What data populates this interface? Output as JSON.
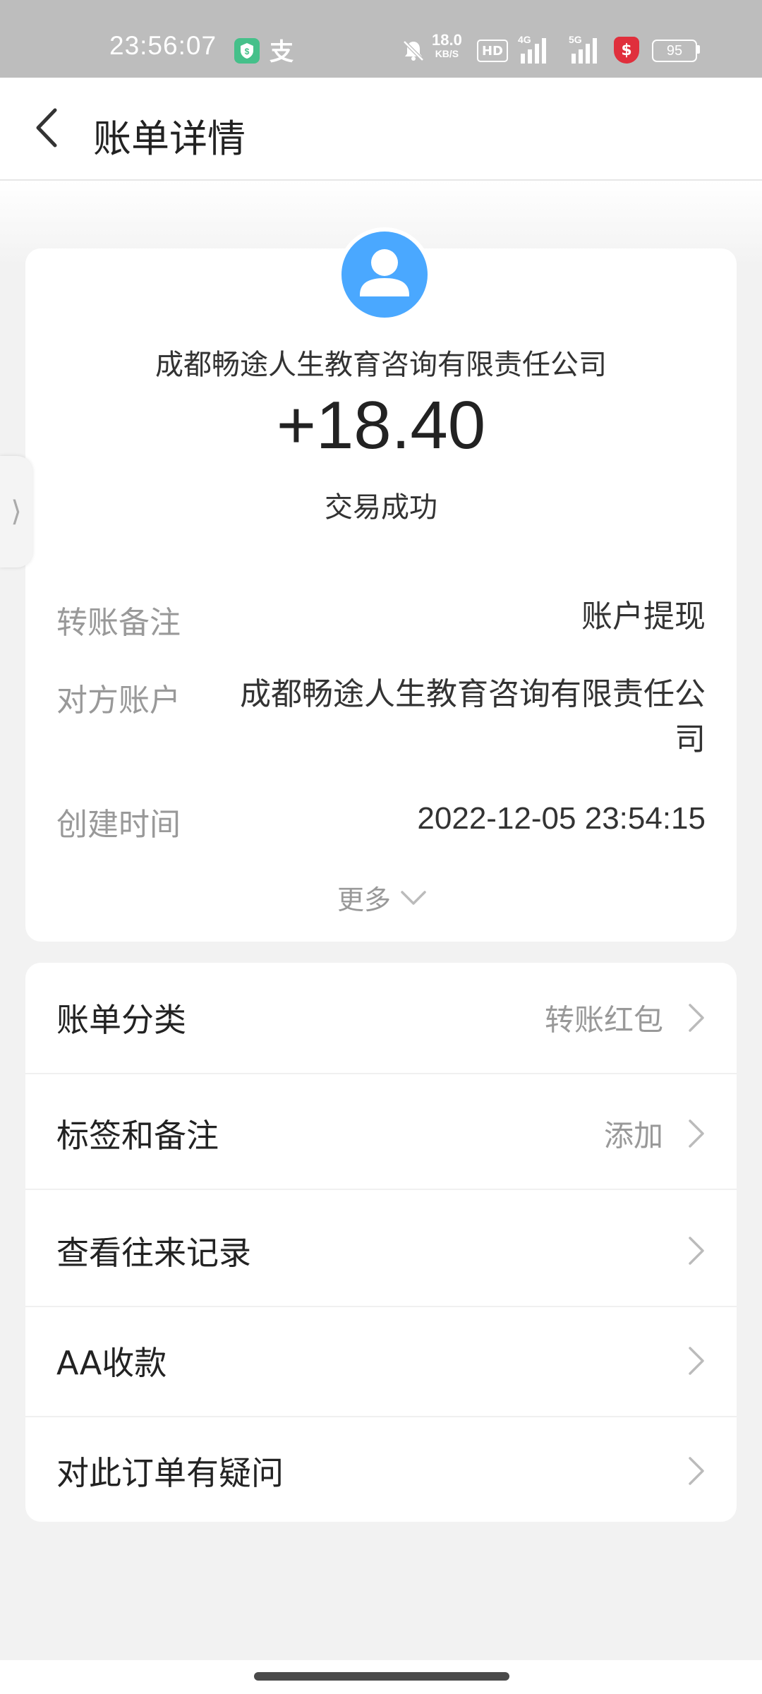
{
  "status_bar": {
    "time": "23:56:07",
    "alipay_glyph": "支",
    "net_speed": "18.0",
    "net_unit": "KB/S",
    "hd_label": "HD",
    "signal_1": "4G",
    "signal_2": "5G",
    "battery": "95",
    "shield_glyph": "$"
  },
  "header": {
    "title": "账单详情"
  },
  "transaction": {
    "counterparty": "成都畅途人生教育咨询有限责任公司",
    "amount": "+18.40",
    "status": "交易成功"
  },
  "details": {
    "note_label": "转账备注",
    "note_value": "账户提现",
    "account_label": "对方账户",
    "account_value_line1": "成都畅途人生教育咨询有限责任公",
    "account_value_line2": "司",
    "time_label": "创建时间",
    "time_value": "2022-12-05 23:54:15",
    "more_label": "更多"
  },
  "side_handle": "⟩",
  "list": [
    {
      "label": "账单分类",
      "value": "转账红包"
    },
    {
      "label": "标签和备注",
      "value": "添加"
    },
    {
      "label": "查看往来记录",
      "value": ""
    },
    {
      "label": "AA收款",
      "value": ""
    },
    {
      "label": "对此订单有疑问",
      "value": ""
    }
  ],
  "colors": {
    "avatar_bg": "#4aa8ff",
    "status_bar_bg": "#bdbdbd",
    "page_bg": "#f2f2f2"
  }
}
